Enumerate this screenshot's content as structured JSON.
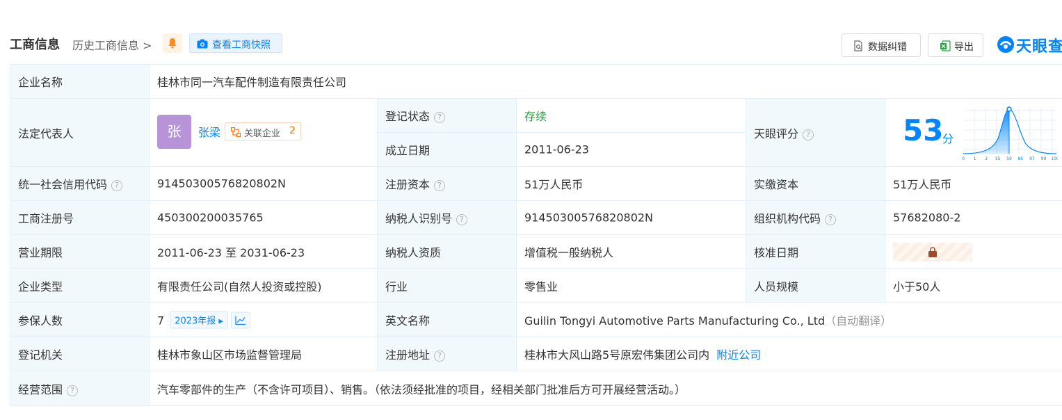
{
  "header": {
    "title": "工商信息",
    "history_link": "历史工商信息 >",
    "snapshot_btn": "查看工商快照",
    "correct_btn": "数据纠错",
    "export_btn": "导出",
    "logo_text": "天眼查"
  },
  "rows": {
    "company_name": {
      "label": "企业名称",
      "value": "桂林市同一汽车配件制造有限责任公司"
    },
    "legal_rep": {
      "label": "法定代表人",
      "avatar_char": "张",
      "name": "张梁",
      "related_label": "关联企业",
      "related_count": "2"
    },
    "reg_status": {
      "label": "登记状态",
      "value": "存续"
    },
    "found_date": {
      "label": "成立日期",
      "value": "2011-06-23"
    },
    "score": {
      "label": "天眼评分",
      "value": "53",
      "unit": "分",
      "axis_ticks": [
        "0",
        "1",
        "3",
        "15",
        "50",
        "85",
        "97",
        "99",
        "100"
      ]
    },
    "credit_code": {
      "label": "统一社会信用代码",
      "value": "91450300576820802N"
    },
    "reg_capital": {
      "label": "注册资本",
      "value": "51万人民币"
    },
    "paid_capital": {
      "label": "实缴资本",
      "value": "51万人民币"
    },
    "reg_no": {
      "label": "工商注册号",
      "value": "450300200035765"
    },
    "taxpayer_id": {
      "label": "纳税人识别号",
      "value": "91450300576820802N"
    },
    "org_code": {
      "label": "组织机构代码",
      "value": "57682080-2"
    },
    "term": {
      "label": "营业期限",
      "value": "2011-06-23 至 2031-06-23"
    },
    "taxpayer_qual": {
      "label": "纳税人资质",
      "value": "增值税一般纳税人"
    },
    "approve_date": {
      "label": "核准日期"
    },
    "company_type": {
      "label": "企业类型",
      "value": "有限责任公司(自然人投资或控股)"
    },
    "industry": {
      "label": "行业",
      "value": "零售业"
    },
    "staff_size": {
      "label": "人员规模",
      "value": "小于50人"
    },
    "insured": {
      "label": "参保人数",
      "value": "7",
      "report": "2023年报"
    },
    "english_name": {
      "label": "英文名称",
      "value": "Guilin Tongyi Automotive Parts Manufacturing Co., Ltd",
      "note": "（自动翻译）"
    },
    "reg_authority": {
      "label": "登记机关",
      "value": "桂林市象山区市场监督管理局"
    },
    "reg_address": {
      "label": "注册地址",
      "value": "桂林市大风山路5号原宏伟集团公司内",
      "nearby": "附近公司"
    },
    "scope": {
      "label": "经营范围",
      "value": "汽车零部件的生产（不含许可项目）、销售。（依法须经批准的项目，经相关部门批准后方可开展经营活动。）"
    }
  },
  "colors": {
    "accent": "#0084ff",
    "label_bg": "#f2f9fc",
    "status_green": "#21a33e",
    "orange": "#ff7200"
  }
}
